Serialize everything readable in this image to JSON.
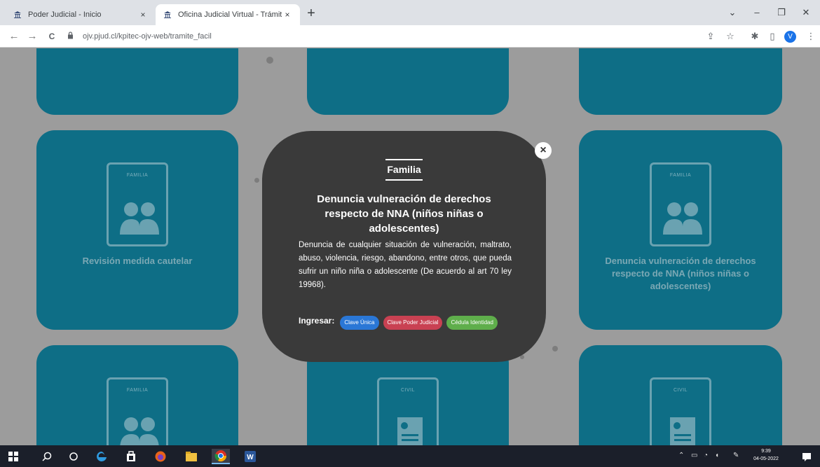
{
  "browser": {
    "tabs": [
      {
        "title": "Poder Judicial - Inicio",
        "close": "×"
      },
      {
        "title": "Oficina Judicial Virtual - Trámite",
        "close": "×"
      }
    ],
    "new_tab": "+",
    "window_controls": {
      "collapse": "⌄",
      "minimize": "–",
      "maximize": "❐",
      "close": "✕"
    },
    "url": "ojv.pjud.cl/kpitec-ojv-web/tramite_facil",
    "nav": {
      "back": "←",
      "forward": "→",
      "reload": "C"
    },
    "profile_initial": "V"
  },
  "cards": [
    {
      "title": ""
    },
    {
      "title": ""
    },
    {
      "title": ""
    },
    {
      "tag": "FAMILIA",
      "title": "Revisión medida cautelar"
    },
    {
      "tag": "FAMILIA",
      "title": "Denuncia vulneración de derechos respecto de NNA (niños niñas o adolescentes)"
    },
    {
      "tag": "FAMILIA",
      "title": ""
    },
    {
      "tag": "CIVIL",
      "title": ""
    },
    {
      "tag": "CIVIL",
      "title": ""
    }
  ],
  "modal": {
    "category": "Familia",
    "close": "×",
    "heading": "Denuncia vulneración de derechos respecto de NNA (niños niñas o adolescentes)",
    "description": "Denuncia de cualquier situación de vulneración, maltrato, abuso, violencia, riesgo, abandono, entre otros, que pueda sufrir un niño niña o adolescente (De acuerdo al art 70 ley 19968).",
    "ingresar_label": "Ingresar:",
    "buttons": {
      "clave_unica": "Clave Única",
      "clave_pj": "Clave Poder Judicial",
      "cedula": "Cédula Identidad"
    }
  },
  "taskbar": {
    "time": "9:39",
    "date": "04-05-2022"
  },
  "colors": {
    "card": "#0e6e86",
    "modal": "#3a3a3a",
    "blue": "#2a77d6",
    "red": "#c94152",
    "green": "#5fae4b"
  }
}
